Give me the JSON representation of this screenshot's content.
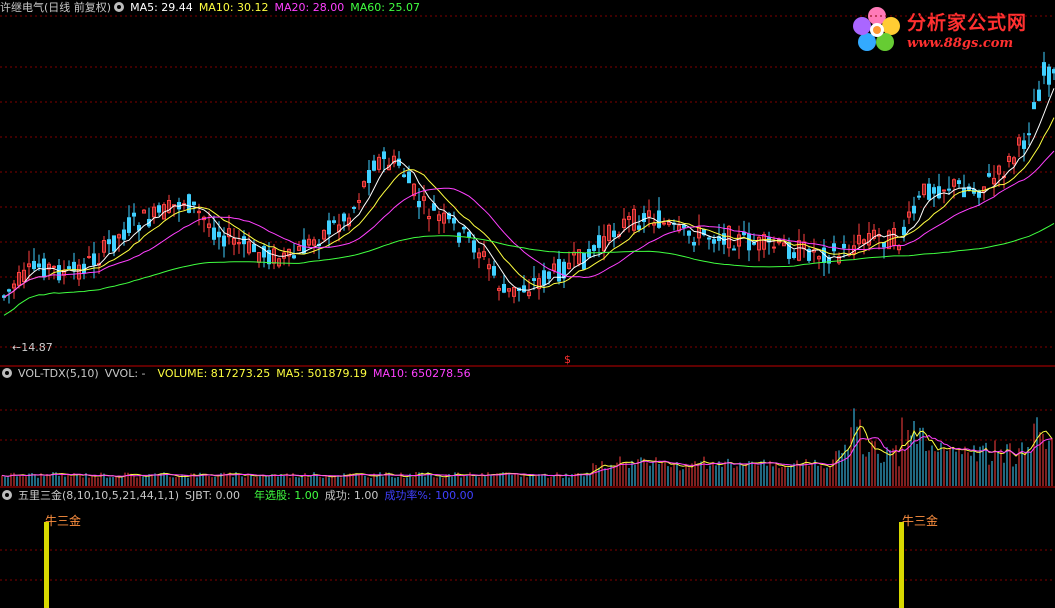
{
  "price_panel": {
    "stock_name": "许继电气",
    "period": "(日线 前复权)",
    "ma5_label": "MA5: 29.44",
    "ma10_label": "MA10: 30.12",
    "ma20_label": "MA20: 28.00",
    "ma60_label": "MA60: 25.07",
    "low_marker": "14.87",
    "signal_marker": "$"
  },
  "volume_panel": {
    "indicator": "VOL-TDX(5,10)",
    "vvol": "VVOL: -",
    "volume_label": "VOLUME: 817273.25",
    "ma5_label": "MA5: 501879.19",
    "ma10_label": "MA10: 650278.56"
  },
  "signal_panel": {
    "indicator": "五里三金(8,10,10,5,21,44,1,1)",
    "sjbt": "SJBT: 0.00",
    "annual_pick": "年选股: 1.00",
    "success": "成功: 1.00",
    "success_rate": "成功率%: 100.00",
    "signal_label_1": "牛三金",
    "signal_label_2": "牛三金"
  },
  "logo": {
    "title": "分析家公式网",
    "url": "www.88gs.com"
  },
  "colors": {
    "background": "#000000",
    "up": "#ff4040",
    "down": "#40d0ff",
    "ma5": "#ffffff",
    "ma10": "#ffff40",
    "ma20": "#ff40ff",
    "ma60": "#40ff40",
    "grid": "#800000",
    "signal": "#d8d800"
  }
}
